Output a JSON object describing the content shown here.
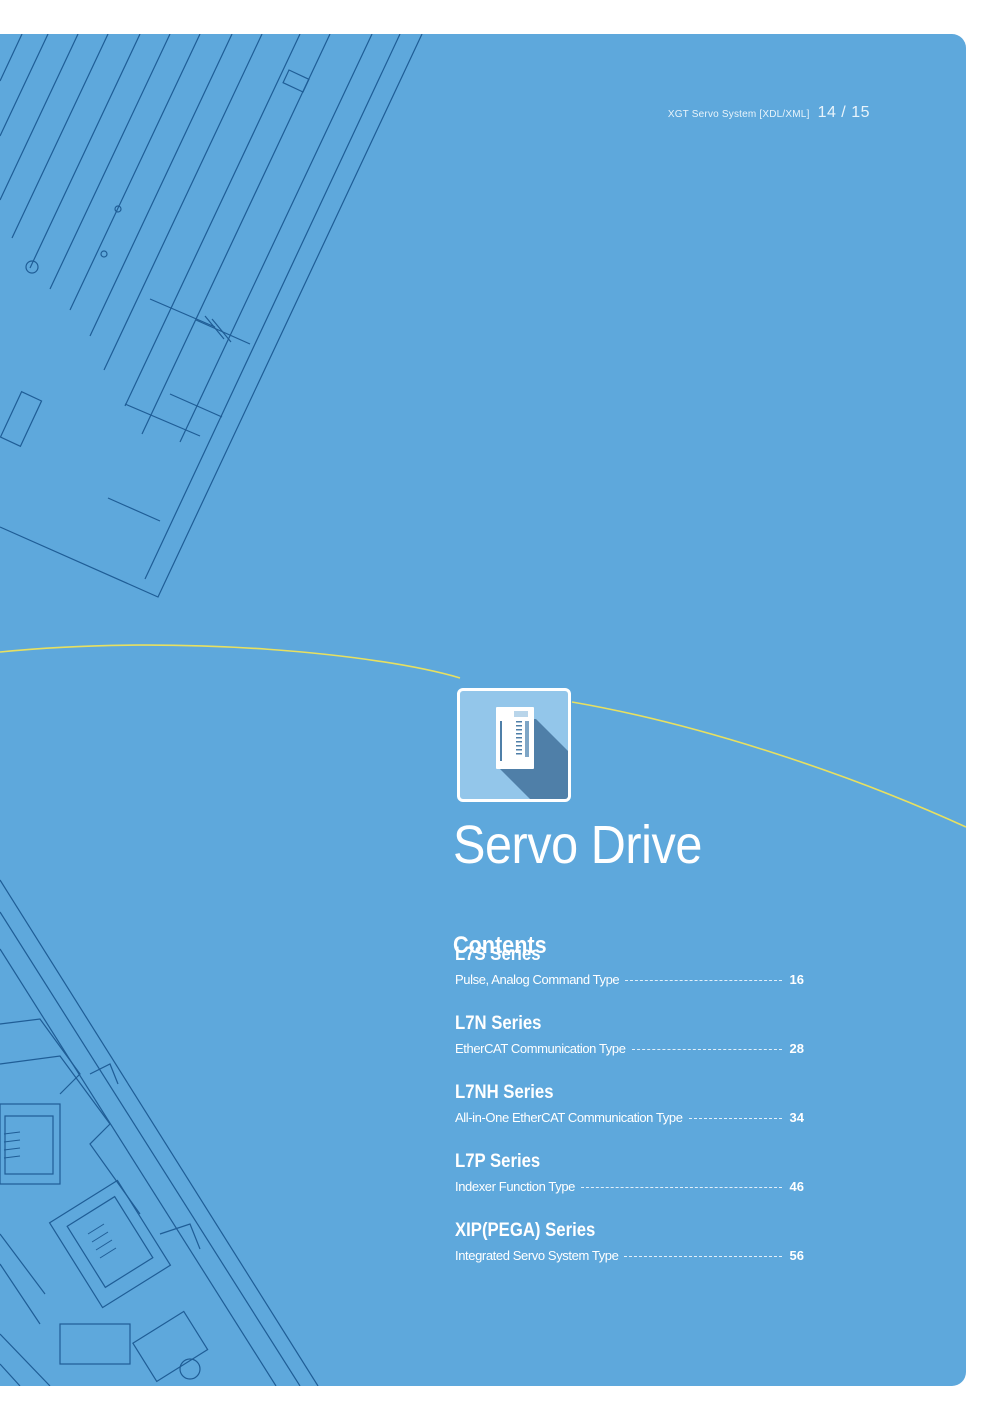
{
  "header": {
    "series": "XGT Servo System [XDL/XML]",
    "pages": "14 / 15"
  },
  "title": "Servo Drive",
  "icon": "servo-drive-icon",
  "contents": {
    "heading": "Contents",
    "items": [
      {
        "name": "L7S Series",
        "desc": "Pulse, Analog Command Type",
        "page": "16"
      },
      {
        "name": "L7N Series",
        "desc": "EtherCAT Communication Type",
        "page": "28"
      },
      {
        "name": "L7NH Series",
        "desc": "All-in-One EtherCAT Communication Type",
        "page": "34"
      },
      {
        "name": "L7P Series",
        "desc": "Indexer Function Type",
        "page": "46"
      },
      {
        "name": "XIP(PEGA) Series",
        "desc": "Integrated Servo System Type",
        "page": "56"
      }
    ]
  },
  "colors": {
    "panel": "#5ea8dc",
    "line": "#1f5d96",
    "accent_curve": "#e8e060",
    "text": "#ffffff"
  }
}
